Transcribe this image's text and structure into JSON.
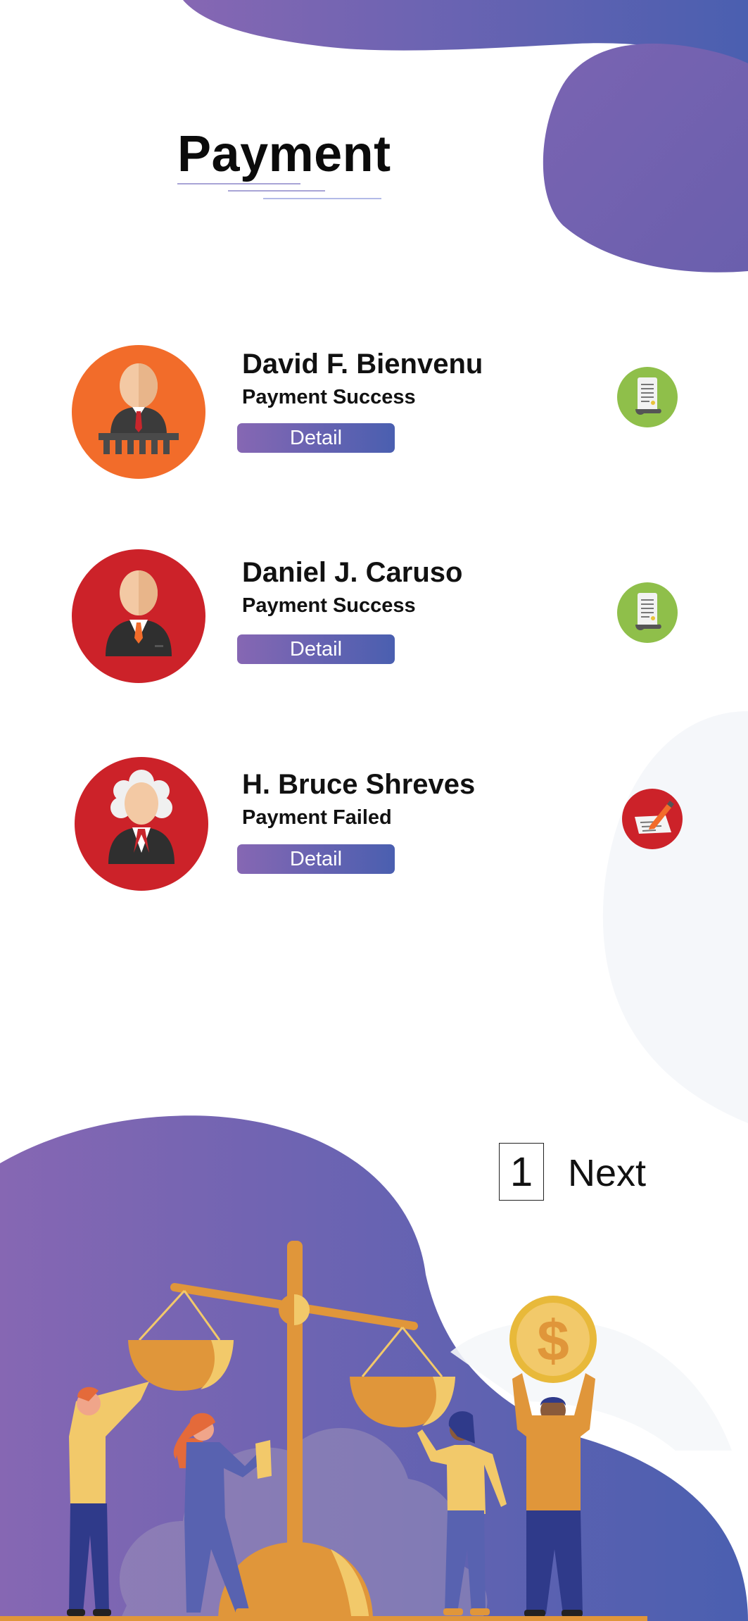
{
  "page": {
    "title": "Payment",
    "colors": {
      "gradient_start": "#8667b3",
      "gradient_end": "#4a5fb0",
      "avatar_orange": "#f26c2a",
      "avatar_red": "#cc2229",
      "success_icon": "#8fbf4a",
      "failed_icon": "#cc2229"
    }
  },
  "payments": [
    {
      "name": "David F. Bienvenu",
      "status": "Payment Success",
      "detail_label": "Detail",
      "avatar_icon": "judge-at-bench-icon",
      "status_icon": "receipt-scroll-icon"
    },
    {
      "name": "Daniel J. Caruso",
      "status": "Payment Success",
      "detail_label": "Detail",
      "avatar_icon": "businessman-icon",
      "status_icon": "receipt-scroll-icon"
    },
    {
      "name": "H. Bruce Shreves",
      "status": "Payment Failed",
      "detail_label": "Detail",
      "avatar_icon": "judge-wig-icon",
      "status_icon": "document-pen-icon"
    }
  ],
  "pagination": {
    "current_page": "1",
    "next_label": "Next"
  },
  "illustration": {
    "icon": "justice-scale-people-illustration"
  }
}
